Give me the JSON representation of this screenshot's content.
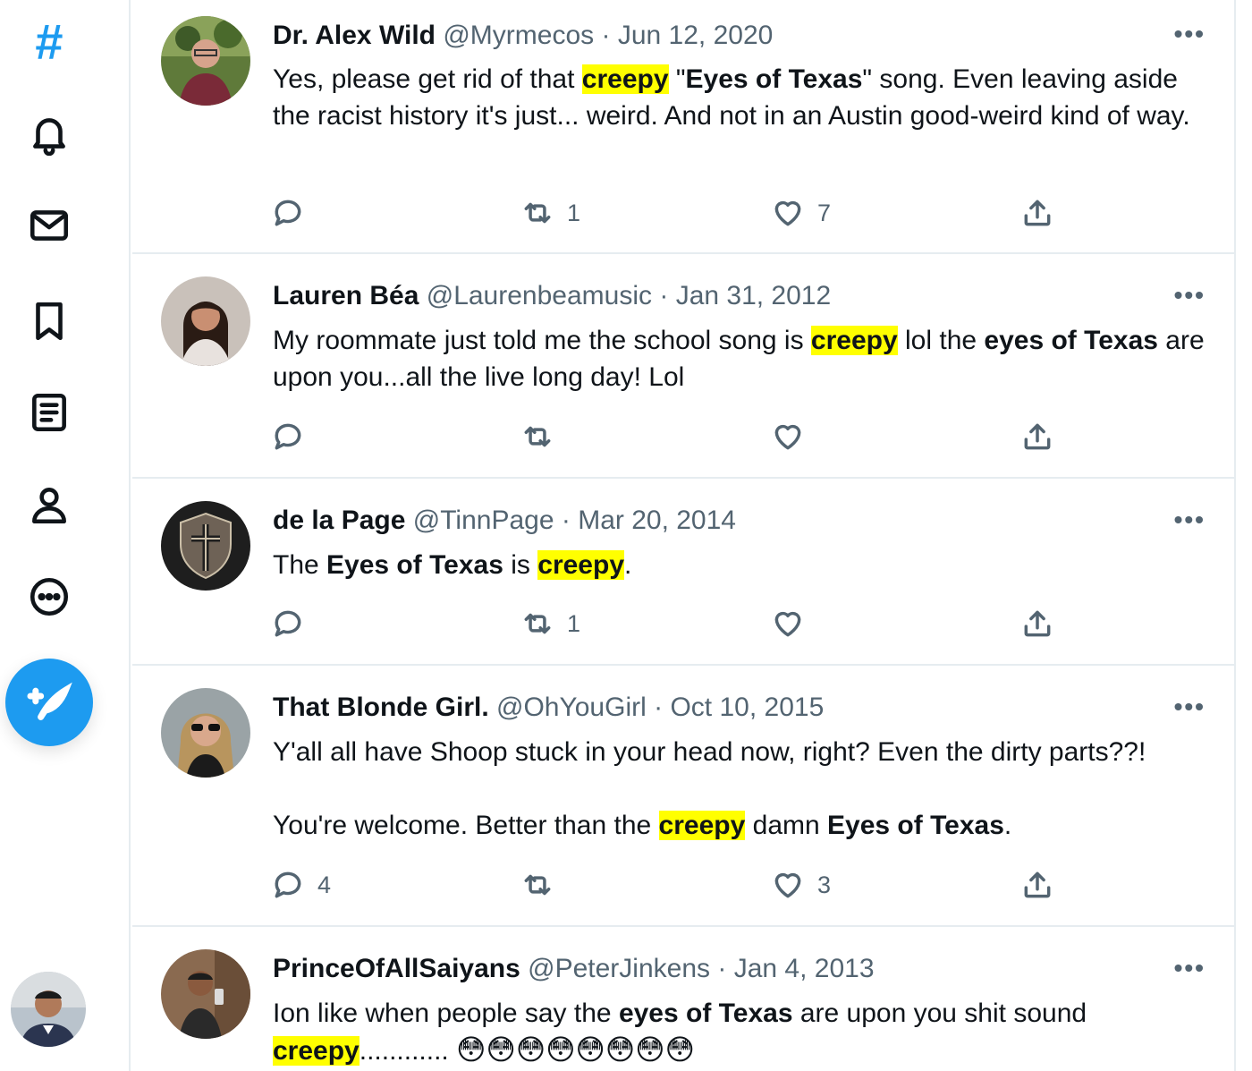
{
  "sidebar": {
    "explore_glyph": "#",
    "icons": [
      "notifications-icon",
      "messages-icon",
      "bookmarks-icon",
      "lists-icon",
      "profile-icon",
      "more-icon"
    ],
    "compose_icon": "compose-feather-icon"
  },
  "tweets": [
    {
      "name": "Dr. Alex Wild",
      "handle": "@Myrmecos",
      "sep": "·",
      "date": "Jun 12, 2020",
      "text": [
        {
          "t": "Yes, please get rid of that "
        },
        {
          "t": "creepy",
          "s": "hl"
        },
        {
          "t": " \""
        },
        {
          "t": "Eyes of Texas",
          "s": "b"
        },
        {
          "t": "\" song. Even leaving aside the racist history it's just... weird. And not in an Austin good-weird kind of way."
        }
      ],
      "reply_count": "",
      "retweet_count": "1",
      "like_count": "7"
    },
    {
      "name": "Lauren Béa",
      "handle": "@Laurenbeamusic",
      "sep": "·",
      "date": "Jan 31, 2012",
      "text": [
        {
          "t": "My roommate just told me the school song is "
        },
        {
          "t": "creepy",
          "s": "hl"
        },
        {
          "t": " lol the "
        },
        {
          "t": "eyes of Texas",
          "s": "b"
        },
        {
          "t": " are upon you...all the live long day! Lol"
        }
      ],
      "reply_count": "",
      "retweet_count": "",
      "like_count": ""
    },
    {
      "name": "de la Page",
      "handle": "@TinnPage",
      "sep": "·",
      "date": "Mar 20, 2014",
      "text": [
        {
          "t": "The "
        },
        {
          "t": "Eyes of Texas",
          "s": "b"
        },
        {
          "t": " is "
        },
        {
          "t": "creepy",
          "s": "hl"
        },
        {
          "t": "."
        }
      ],
      "reply_count": "",
      "retweet_count": "1",
      "like_count": ""
    },
    {
      "name": "That Blonde Girl.",
      "handle": "@OhYouGirl",
      "sep": "·",
      "date": "Oct 10, 2015",
      "text": [
        {
          "t": "Y'all all have Shoop stuck in your head now, right? Even the dirty parts??!\n\nYou're welcome. Better than the "
        },
        {
          "t": "creepy",
          "s": "hl"
        },
        {
          "t": " damn "
        },
        {
          "t": "Eyes of Texas",
          "s": "b"
        },
        {
          "t": "."
        }
      ],
      "reply_count": "4",
      "retweet_count": "",
      "like_count": "3"
    },
    {
      "name": "PrinceOfAllSaiyans",
      "handle": "@PeterJinkens",
      "sep": "·",
      "date": "Jan 4, 2013",
      "text": [
        {
          "t": "Ion like when people say the "
        },
        {
          "t": "eyes of Texas",
          "s": "b"
        },
        {
          "t": " are upon you shit sound "
        },
        {
          "t": "creepy",
          "s": "hl"
        },
        {
          "t": "............ "
        },
        {
          "t": "😳😳😳😳😳😳😳😳",
          "s": "emoji"
        }
      ],
      "reply_count": "",
      "retweet_count": "",
      "like_count": ""
    }
  ],
  "colors": {
    "accent": "#1d9bf0",
    "highlight": "#ffff00",
    "secondary_text": "#536471",
    "divider": "#e6ecf0"
  }
}
